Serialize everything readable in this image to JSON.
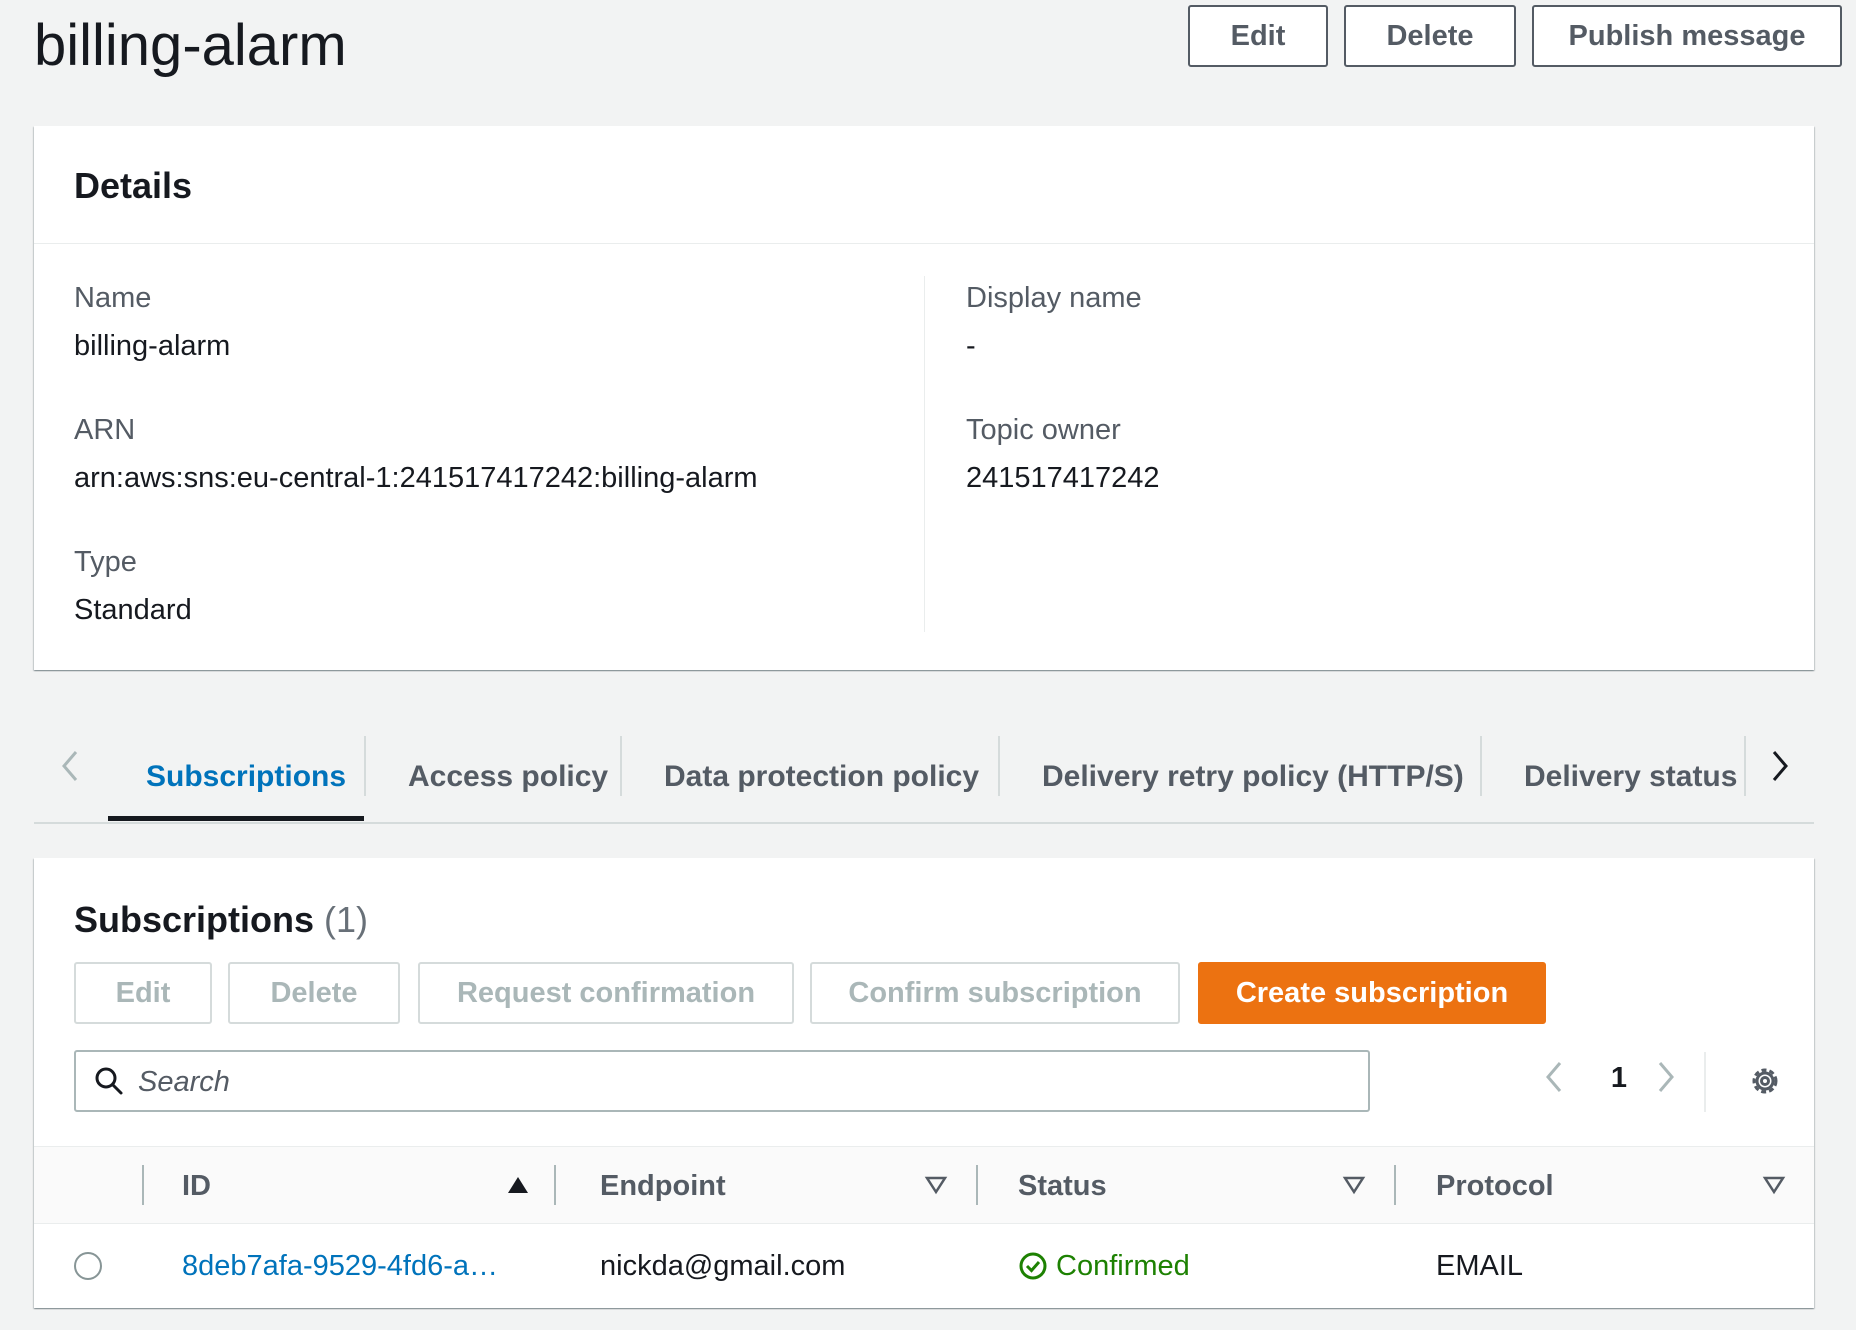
{
  "header": {
    "title": "billing-alarm",
    "edit_label": "Edit",
    "delete_label": "Delete",
    "publish_label": "Publish message"
  },
  "details": {
    "title": "Details",
    "name_label": "Name",
    "name_value": "billing-alarm",
    "arn_label": "ARN",
    "arn_value": "arn:aws:sns:eu-central-1:241517417242:billing-alarm",
    "type_label": "Type",
    "type_value": "Standard",
    "display_name_label": "Display name",
    "display_name_value": "-",
    "topic_owner_label": "Topic owner",
    "topic_owner_value": "241517417242"
  },
  "tabs": [
    {
      "label": "Subscriptions",
      "active": true
    },
    {
      "label": "Access policy"
    },
    {
      "label": "Data protection policy"
    },
    {
      "label": "Delivery retry policy (HTTP/S)"
    },
    {
      "label": "Delivery status l"
    }
  ],
  "subscriptions": {
    "title": "Subscriptions",
    "count": "(1)",
    "edit_label": "Edit",
    "delete_label": "Delete",
    "request_confirmation_label": "Request confirmation",
    "confirm_subscription_label": "Confirm subscription",
    "create_subscription_label": "Create subscription",
    "search_placeholder": "Search",
    "page": "1",
    "columns": [
      "ID",
      "Endpoint",
      "Status",
      "Protocol"
    ],
    "rows": [
      {
        "id": "8deb7afa-9529-4fd6-a…",
        "endpoint": "nickda@gmail.com",
        "status": "Confirmed",
        "protocol": "EMAIL"
      }
    ]
  },
  "colors": {
    "accent_link": "#0073bb",
    "primary_button": "#ec7211",
    "status_ok": "#1d8102"
  },
  "icons": {
    "search": "search-icon",
    "settings": "gear-icon",
    "confirmed": "check-circle-icon",
    "sort_asc": "caret-up-icon",
    "sort": "caret-down-icon"
  }
}
